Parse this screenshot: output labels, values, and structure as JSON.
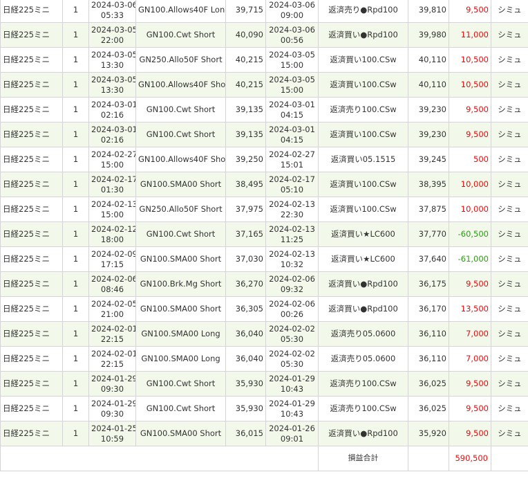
{
  "rows": [
    {
      "product": "日経225ミニ",
      "qty": "1",
      "entry_date": "2024-03-06",
      "entry_time": "05:33",
      "strategy": "GN100.Allows40F Long",
      "entry_price": "39,715",
      "exit_date": "2024-03-06",
      "exit_time": "09:00",
      "exit_reason": "返済売り●Rpd100",
      "exit_price": "39,810",
      "pl": "9,500",
      "sign": "pos",
      "mode": "シミュ"
    },
    {
      "product": "日経225ミニ",
      "qty": "1",
      "entry_date": "2024-03-05",
      "entry_time": "22:00",
      "strategy": "GN100.Cwt Short",
      "entry_price": "40,090",
      "exit_date": "2024-03-06",
      "exit_time": "00:56",
      "exit_reason": "返済買い●Rpd100",
      "exit_price": "39,980",
      "pl": "11,000",
      "sign": "pos",
      "mode": "シミュ"
    },
    {
      "product": "日経225ミニ",
      "qty": "1",
      "entry_date": "2024-03-05",
      "entry_time": "13:30",
      "strategy": "GN250.Allo50F Short",
      "entry_price": "40,215",
      "exit_date": "2024-03-05",
      "exit_time": "15:00",
      "exit_reason": "返済買い100.CSw",
      "exit_price": "40,110",
      "pl": "10,500",
      "sign": "pos",
      "mode": "シミュ"
    },
    {
      "product": "日経225ミニ",
      "qty": "1",
      "entry_date": "2024-03-05",
      "entry_time": "13:30",
      "strategy": "GN100.Allows40F Short",
      "entry_price": "40,215",
      "exit_date": "2024-03-05",
      "exit_time": "15:00",
      "exit_reason": "返済買い100.CSw",
      "exit_price": "40,110",
      "pl": "10,500",
      "sign": "pos",
      "mode": "シミュ"
    },
    {
      "product": "日経225ミニ",
      "qty": "1",
      "entry_date": "2024-03-01",
      "entry_time": "02:16",
      "strategy": "GN100.Cwt Short",
      "entry_price": "39,135",
      "exit_date": "2024-03-01",
      "exit_time": "04:15",
      "exit_reason": "返済売り100.CSw",
      "exit_price": "39,230",
      "pl": "9,500",
      "sign": "pos",
      "mode": "シミュ"
    },
    {
      "product": "日経225ミニ",
      "qty": "1",
      "entry_date": "2024-03-01",
      "entry_time": "02:16",
      "strategy": "GN100.Cwt Short",
      "entry_price": "39,135",
      "exit_date": "2024-03-01",
      "exit_time": "04:15",
      "exit_reason": "返済買い100.CSw",
      "exit_price": "39,230",
      "pl": "9,500",
      "sign": "pos",
      "mode": "シミュ"
    },
    {
      "product": "日経225ミニ",
      "qty": "1",
      "entry_date": "2024-02-27",
      "entry_time": "15:00",
      "strategy": "GN100.Allows40F Short",
      "entry_price": "39,250",
      "exit_date": "2024-02-27",
      "exit_time": "15:01",
      "exit_reason": "返済買い05.1515",
      "exit_price": "39,245",
      "pl": "500",
      "sign": "pos",
      "mode": "シミュ"
    },
    {
      "product": "日経225ミニ",
      "qty": "1",
      "entry_date": "2024-02-17",
      "entry_time": "01:30",
      "strategy": "GN100.SMA00 Short",
      "entry_price": "38,495",
      "exit_date": "2024-02-17",
      "exit_time": "05:10",
      "exit_reason": "返済買い100.CSw",
      "exit_price": "38,395",
      "pl": "10,000",
      "sign": "pos",
      "mode": "シミュ"
    },
    {
      "product": "日経225ミニ",
      "qty": "1",
      "entry_date": "2024-02-13",
      "entry_time": "15:00",
      "strategy": "GN250.Allo50F Short",
      "entry_price": "37,975",
      "exit_date": "2024-02-13",
      "exit_time": "22:30",
      "exit_reason": "返済買い100.CSw",
      "exit_price": "37,875",
      "pl": "10,000",
      "sign": "pos",
      "mode": "シミュ"
    },
    {
      "product": "日経225ミニ",
      "qty": "1",
      "entry_date": "2024-02-12",
      "entry_time": "18:00",
      "strategy": "GN100.Cwt Short",
      "entry_price": "37,165",
      "exit_date": "2024-02-13",
      "exit_time": "11:25",
      "exit_reason": "返済買い★LC600",
      "exit_price": "37,770",
      "pl": "-60,500",
      "sign": "neg",
      "mode": "シミュ"
    },
    {
      "product": "日経225ミニ",
      "qty": "1",
      "entry_date": "2024-02-09",
      "entry_time": "17:15",
      "strategy": "GN100.SMA00 Short",
      "entry_price": "37,030",
      "exit_date": "2024-02-13",
      "exit_time": "10:32",
      "exit_reason": "返済買い★LC600",
      "exit_price": "37,640",
      "pl": "-61,000",
      "sign": "neg",
      "mode": "シミュ"
    },
    {
      "product": "日経225ミニ",
      "qty": "1",
      "entry_date": "2024-02-06",
      "entry_time": "08:46",
      "strategy": "GN100.Brk.Mg Short",
      "entry_price": "36,270",
      "exit_date": "2024-02-06",
      "exit_time": "09:32",
      "exit_reason": "返済買い●Rpd100",
      "exit_price": "36,175",
      "pl": "9,500",
      "sign": "pos",
      "mode": "シミュ"
    },
    {
      "product": "日経225ミニ",
      "qty": "1",
      "entry_date": "2024-02-05",
      "entry_time": "21:00",
      "strategy": "GN100.SMA00 Short",
      "entry_price": "36,305",
      "exit_date": "2024-02-06",
      "exit_time": "00:26",
      "exit_reason": "返済買い●Rpd100",
      "exit_price": "36,170",
      "pl": "13,500",
      "sign": "pos",
      "mode": "シミュ"
    },
    {
      "product": "日経225ミニ",
      "qty": "1",
      "entry_date": "2024-02-01",
      "entry_time": "22:15",
      "strategy": "GN100.SMA00 Long",
      "entry_price": "36,040",
      "exit_date": "2024-02-02",
      "exit_time": "05:30",
      "exit_reason": "返済売り05.0600",
      "exit_price": "36,110",
      "pl": "7,000",
      "sign": "pos",
      "mode": "シミュ"
    },
    {
      "product": "日経225ミニ",
      "qty": "1",
      "entry_date": "2024-02-01",
      "entry_time": "22:15",
      "strategy": "GN100.SMA00 Long",
      "entry_price": "36,040",
      "exit_date": "2024-02-02",
      "exit_time": "05:30",
      "exit_reason": "返済売り05.0600",
      "exit_price": "36,110",
      "pl": "7,000",
      "sign": "pos",
      "mode": "シミュ"
    },
    {
      "product": "日経225ミニ",
      "qty": "1",
      "entry_date": "2024-01-29",
      "entry_time": "09:30",
      "strategy": "GN100.Cwt Short",
      "entry_price": "35,930",
      "exit_date": "2024-01-29",
      "exit_time": "10:43",
      "exit_reason": "返済売り100.CSw",
      "exit_price": "36,025",
      "pl": "9,500",
      "sign": "pos",
      "mode": "シミュ"
    },
    {
      "product": "日経225ミニ",
      "qty": "1",
      "entry_date": "2024-01-29",
      "entry_time": "09:30",
      "strategy": "GN100.Cwt Short",
      "entry_price": "35,930",
      "exit_date": "2024-01-29",
      "exit_time": "10:43",
      "exit_reason": "返済売り100.CSw",
      "exit_price": "36,025",
      "pl": "9,500",
      "sign": "pos",
      "mode": "シミュ"
    },
    {
      "product": "日経225ミニ",
      "qty": "1",
      "entry_date": "2024-01-25",
      "entry_time": "10:59",
      "strategy": "GN100.SMA00 Short",
      "entry_price": "36,015",
      "exit_date": "2024-01-26",
      "exit_time": "09:01",
      "exit_reason": "返済買い●Rpd100",
      "exit_price": "35,920",
      "pl": "9,500",
      "sign": "pos",
      "mode": "シミュ"
    }
  ],
  "total": {
    "label": "損益合計",
    "value": "590,500"
  },
  "colors": {
    "positive": "#e01010",
    "negative": "#2e9a17",
    "row_alt_bg": "#f2f9ea",
    "border": "#d4d4d4"
  }
}
